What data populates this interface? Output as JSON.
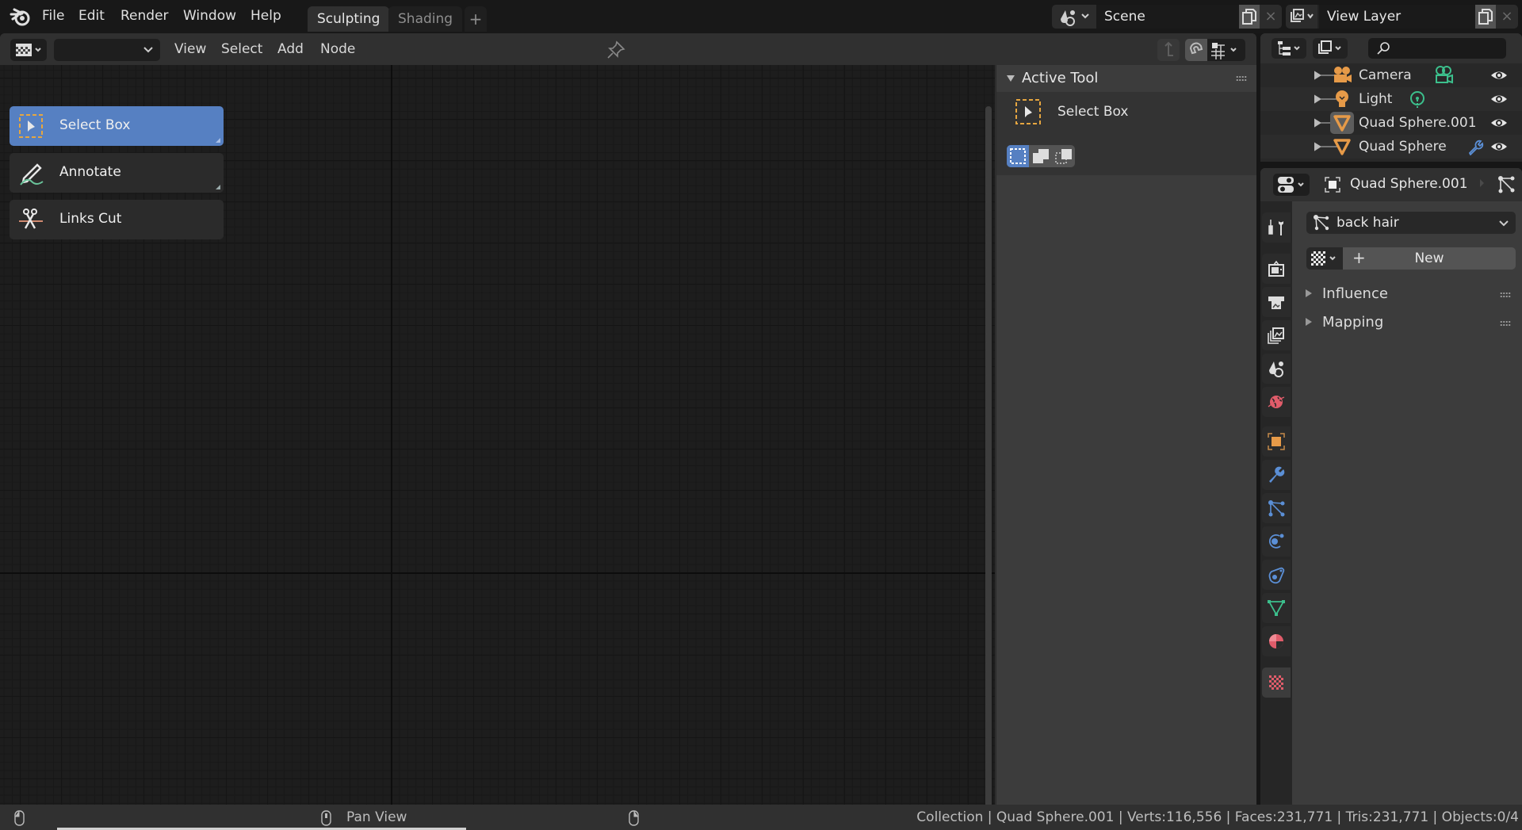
{
  "topbar": {
    "menus": [
      "File",
      "Edit",
      "Render",
      "Window",
      "Help"
    ],
    "workspaces": [
      {
        "label": "Sculpting",
        "active": true
      },
      {
        "label": "Shading",
        "active": false
      }
    ],
    "add_workspace": "+",
    "scene": {
      "name": "Scene",
      "close": "×"
    },
    "view_layer": {
      "name": "View Layer",
      "close": "×"
    }
  },
  "node_editor": {
    "header": {
      "editor_type_icon": "texture-node-editor-icon",
      "slot_dropdown_value": "",
      "menus": [
        "View",
        "Select",
        "Add",
        "Node"
      ]
    },
    "toolbar": [
      {
        "label": "Select Box",
        "icon": "select-box-icon",
        "active": true
      },
      {
        "label": "Annotate",
        "icon": "annotate-icon",
        "active": false
      },
      {
        "label": "Links Cut",
        "icon": "links-cut-icon",
        "active": false
      }
    ],
    "sidebar": {
      "panel_title": "Active Tool",
      "tool_name": "Select Box",
      "modes": [
        "set-mode",
        "extend-mode",
        "subtract-mode"
      ]
    }
  },
  "outliner": {
    "search_placeholder": "",
    "items": [
      {
        "label": "Camera",
        "type_icon": "camera-icon",
        "data_icon": "camera-data-icon"
      },
      {
        "label": "Light",
        "type_icon": "light-icon",
        "data_icon": "light-data-icon"
      },
      {
        "label": "Quad Sphere.001",
        "type_icon": "mesh-icon",
        "data_icon": ""
      },
      {
        "label": "Quad Sphere",
        "type_icon": "mesh-icon",
        "data_icon": "modifier-wrench-icon"
      }
    ]
  },
  "properties": {
    "object_name": "Quad Sphere.001",
    "particle_system": "back hair",
    "new_button": "New",
    "new_plus": "+",
    "panels": [
      "Influence",
      "Mapping"
    ],
    "tabs": [
      "tool",
      "render",
      "output",
      "view-layer",
      "scene",
      "world",
      "object",
      "modifiers",
      "particles",
      "physics",
      "constraints",
      "data",
      "material",
      "texture"
    ],
    "active_tab": "texture"
  },
  "statusbar": {
    "middle_hint": "Pan View",
    "stats": "Collection | Quad Sphere.001 | Verts:116,556 | Faces:231,771 | Tris:231,771 | Objects:0/4"
  },
  "colors": {
    "accent": "#5680c2",
    "orange": "#e69a48",
    "green": "#3cbf8c",
    "blue": "#5b8fd6",
    "red": "#e05c6a"
  }
}
